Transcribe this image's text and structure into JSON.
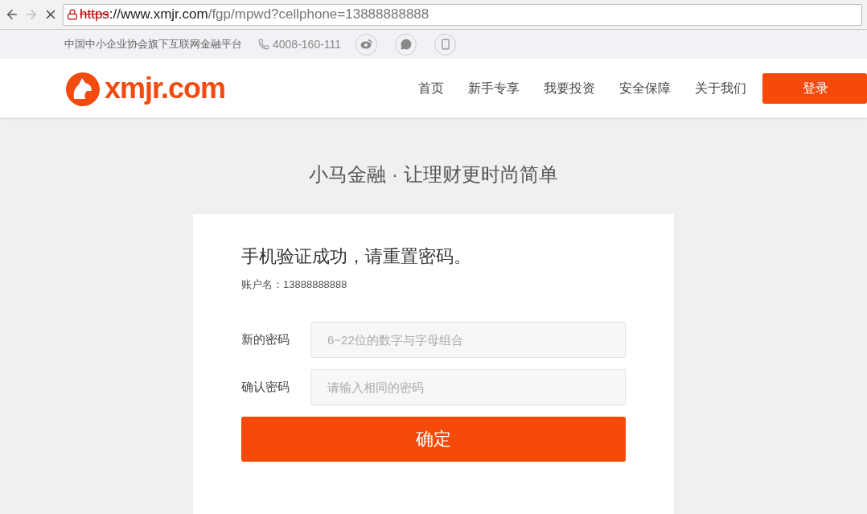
{
  "browser": {
    "loading": true,
    "url": {
      "scheme": "https",
      "secure": false,
      "host": "://www.xmjr.com",
      "path": "/fgp/mpwd?cellphone=13888888888"
    }
  },
  "top_bar": {
    "slogan": "中国中小企业协会旗下互联网金融平台",
    "phone": "4008-160-111"
  },
  "header": {
    "logo_text": "xmjr.com",
    "nav": [
      {
        "label": "首页"
      },
      {
        "label": "新手专享"
      },
      {
        "label": "我要投资"
      },
      {
        "label": "安全保障"
      },
      {
        "label": "关于我们"
      }
    ],
    "login": "登录"
  },
  "tagline": "小马金融 · 让理财更时尚简单",
  "form": {
    "title": "手机验证成功，请重置密码。",
    "account": "账户名：13888888888",
    "fields": [
      {
        "label": "新的密码",
        "placeholder": "6~22位的数字与字母组合"
      },
      {
        "label": "确认密码",
        "placeholder": "请输入相同的密码"
      }
    ],
    "submit": "确定"
  }
}
